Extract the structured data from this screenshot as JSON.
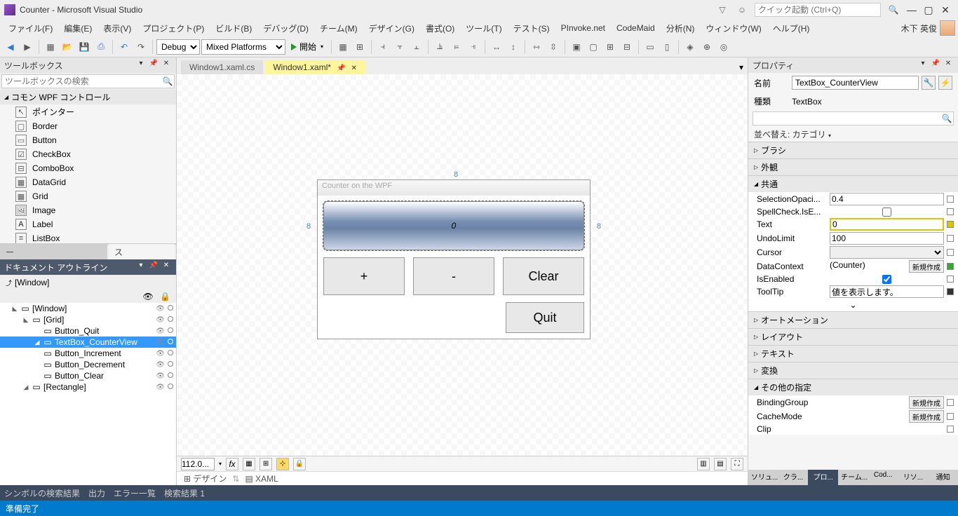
{
  "titlebar": {
    "title": "Counter - Microsoft Visual Studio",
    "quick_launch_placeholder": "クイック起動 (Ctrl+Q)"
  },
  "menubar": {
    "items": [
      "ファイル(F)",
      "編集(E)",
      "表示(V)",
      "プロジェクト(P)",
      "ビルド(B)",
      "デバッグ(D)",
      "チーム(M)",
      "デザイン(G)",
      "書式(O)",
      "ツール(T)",
      "テスト(S)",
      "PInvoke.net",
      "CodeMaid",
      "分析(N)",
      "ウィンドウ(W)",
      "ヘルプ(H)"
    ],
    "user": "木下 英俊"
  },
  "toolbar": {
    "config": "Debug",
    "platform": "Mixed Platforms",
    "start": "開始"
  },
  "toolbox": {
    "title": "ツールボックス",
    "search_placeholder": "ツールボックスの検索",
    "group": "コモン WPF コントロール",
    "items": [
      "ポインター",
      "Border",
      "Button",
      "CheckBox",
      "ComboBox",
      "DataGrid",
      "Grid",
      "Image",
      "Label",
      "ListBox"
    ],
    "tab1": "サーバー エクスプローラー",
    "tab2": "ツールボックス"
  },
  "outline": {
    "title": "ドキュメント アウトライン",
    "root": "[Window]",
    "rows": [
      {
        "indent": 0,
        "exp": "◣",
        "label": "[Window]"
      },
      {
        "indent": 1,
        "exp": "◣",
        "label": "[Grid]"
      },
      {
        "indent": 2,
        "exp": "",
        "label": "Button_Quit"
      },
      {
        "indent": 2,
        "exp": "◢",
        "label": "TextBox_CounterView",
        "sel": true
      },
      {
        "indent": 2,
        "exp": "",
        "label": "Button_Increment"
      },
      {
        "indent": 2,
        "exp": "",
        "label": "Button_Decrement"
      },
      {
        "indent": 2,
        "exp": "",
        "label": "Button_Clear"
      },
      {
        "indent": 1,
        "exp": "◢",
        "label": "[Rectangle]"
      }
    ]
  },
  "tabs": {
    "t1": "Window1.xaml.cs",
    "t2": "Window1.xaml*"
  },
  "designer": {
    "wintitle": "Counter on the WPF",
    "value": "0",
    "plus": "+",
    "minus": "-",
    "clear": "Clear",
    "quit": "Quit",
    "margin_h": "8",
    "margin_v": "8",
    "zoom": "112.0...",
    "mode_design": "デザイン",
    "mode_xaml": "XAML"
  },
  "properties": {
    "title": "プロパティ",
    "name_label": "名前",
    "name_value": "TextBox_CounterView",
    "type_label": "種類",
    "type_value": "TextBox",
    "sort_label": "並べ替え: カテゴリ",
    "cats": {
      "brush": "ブラシ",
      "appearance": "外観",
      "common": "共通",
      "automation": "オートメーション",
      "layout": "レイアウト",
      "text": "テキスト",
      "transform": "変換",
      "misc": "その他の指定"
    },
    "rows": {
      "sel_opacity_l": "SelectionOpaci...",
      "sel_opacity_v": "0.4",
      "spell_l": "SpellCheck.IsE...",
      "text_l": "Text",
      "text_v": "0",
      "undo_l": "UndoLimit",
      "undo_v": "100",
      "cursor_l": "Cursor",
      "cursor_v": "",
      "dc_l": "DataContext",
      "dc_v": "(Counter)",
      "enabled_l": "IsEnabled",
      "tooltip_l": "ToolTip",
      "tooltip_v": "値を表示します。",
      "bg_l": "BindingGroup",
      "cm_l": "CacheMode",
      "clip_l": "Clip",
      "new_btn": "新規作成"
    },
    "rtabs": [
      "ソリュ...",
      "クラ...",
      "プロ...",
      "チーム...",
      "Cod...",
      "リソ...",
      "通知"
    ]
  },
  "bottom": {
    "t1": "シンボルの検索結果",
    "t2": "出力",
    "t3": "エラー一覧",
    "t4": "検索結果 1"
  },
  "status": {
    "text": "準備完了"
  }
}
